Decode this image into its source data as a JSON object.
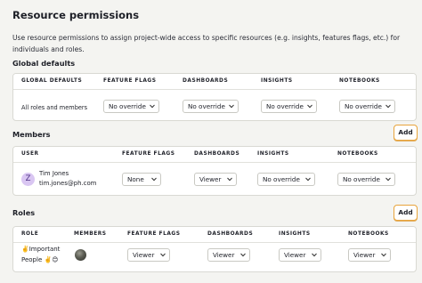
{
  "page": {
    "title": "Resource permissions",
    "description": "Use resource permissions to assign project-wide access to specific resources (e.g. insights, features flags, etc.) for individuals and roles."
  },
  "global_defaults": {
    "title": "Global defaults",
    "headers": [
      "GLOBAL DEFAULTS",
      "FEATURE FLAGS",
      "DASHBOARDS",
      "INSIGHTS",
      "NOTEBOOKS"
    ],
    "row_label": "All roles and members",
    "values": [
      "No override",
      "No override",
      "No override",
      "No override"
    ]
  },
  "members": {
    "title": "Members",
    "add_label": "Add",
    "headers": [
      "USER",
      "FEATURE FLAGS",
      "DASHBOARDS",
      "INSIGHTS",
      "NOTEBOOKS"
    ],
    "rows": [
      {
        "avatar_letter": "Z",
        "name": "Tim Jones",
        "email": "tim.jones@ph.com",
        "values": [
          "None",
          "Viewer",
          "No override",
          "No override"
        ]
      }
    ]
  },
  "roles": {
    "title": "Roles",
    "add_label": "Add",
    "headers": [
      "ROLE",
      "MEMBERS",
      "FEATURE FLAGS",
      "DASHBOARDS",
      "INSIGHTS",
      "NOTEBOOKS"
    ],
    "rows": [
      {
        "name_line1": "✌️Important",
        "name_line2": "People ✌️😊",
        "values": [
          "Viewer",
          "Viewer",
          "Viewer",
          "Viewer"
        ]
      }
    ]
  },
  "icons": {
    "select_chevron": "chevron-down-icon",
    "member_avatar": "avatar-photo"
  },
  "colors": {
    "background": "#f4f4f1",
    "accent_border": "#e8a43c",
    "avatar_bg": "#d9c6f2",
    "avatar_fg": "#4b2f83"
  }
}
